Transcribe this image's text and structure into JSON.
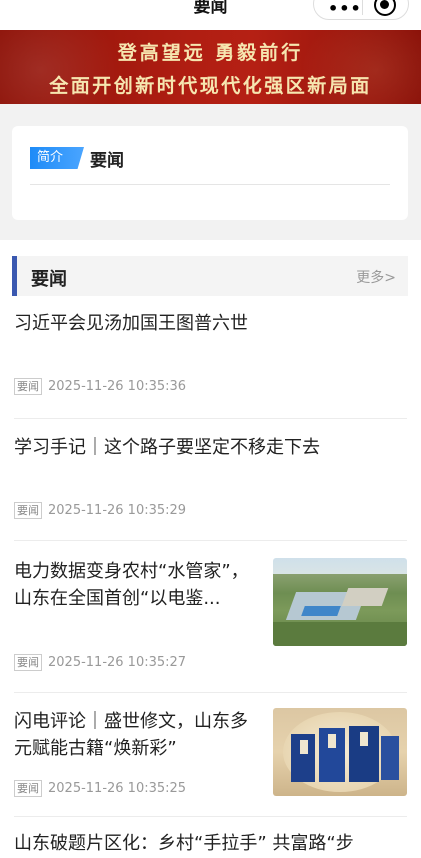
{
  "nav": {
    "title": "要闻",
    "more_glyph": "•••",
    "close_icon": "target-close-icon"
  },
  "banner": {
    "line1": "登高望远  勇毅前行",
    "line2": "全面开创新时代现代化强区新局面",
    "colors": {
      "bg": "#b01e12",
      "text": "#f6e6b0"
    }
  },
  "intro": {
    "tag": "简介",
    "title": "要闻",
    "tag_color": "#1e8bf7"
  },
  "section": {
    "title": "要闻",
    "more": "更多>",
    "accent": "#3a58b0"
  },
  "news": [
    {
      "headline": "习近平会见汤加国王图普六世",
      "badge": "要闻",
      "date": "2025-11-26 10:35:36",
      "has_image": false
    },
    {
      "headline": "学习手记｜这个路子要坚定不移走下去",
      "badge": "要闻",
      "date": "2025-11-26 10:35:29",
      "has_image": false
    },
    {
      "headline": "电力数据变身农村“水管家”，山东在全国首创“以电鉴...",
      "badge": "要闻",
      "date": "2025-11-26 10:35:27",
      "has_image": true
    },
    {
      "headline": "闪电评论｜盛世修文，山东多元赋能古籍“焕新彩”",
      "badge": "要闻",
      "date": "2025-11-26 10:35:25",
      "has_image": true
    },
    {
      "headline": "山东破题片区化：乡村“手拉手” 共富路“步",
      "badge": "",
      "date": "",
      "has_image": false
    }
  ]
}
